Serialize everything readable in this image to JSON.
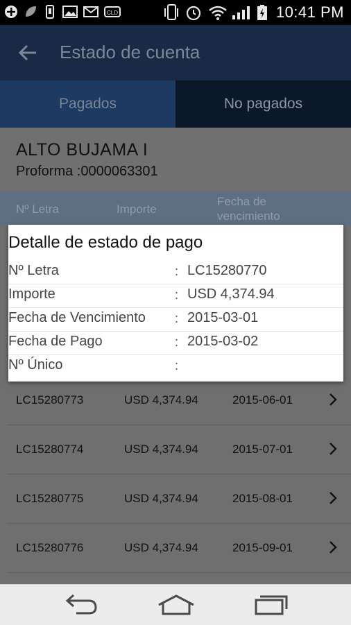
{
  "status_bar": {
    "time": "10:41 PM",
    "icons": [
      "add-icon",
      "leaf-icon",
      "usb-icon",
      "image-icon",
      "gmail-icon",
      "cloud-drive-icon",
      "phone-vibrate-icon",
      "alarm-icon",
      "wifi-icon",
      "signal-icon",
      "battery-icon"
    ]
  },
  "app_bar": {
    "title": "Estado de cuenta",
    "back_icon": "back-arrow-icon"
  },
  "tabs": [
    {
      "label": "Pagados",
      "selected": true
    },
    {
      "label": "No pagados",
      "selected": false
    }
  ],
  "project": {
    "name": "ALTO BUJAMA I",
    "proforma": "Proforma :0000063301"
  },
  "columns": {
    "letra": "Nº Letra",
    "importe": "Importe",
    "fecha": "Fecha de vencimiento"
  },
  "rows": [
    {
      "letra": "LC15280773",
      "importe": "USD 4,374.94",
      "fecha": "2015-06-01"
    },
    {
      "letra": "LC15280774",
      "importe": "USD 4,374.94",
      "fecha": "2015-07-01"
    },
    {
      "letra": "LC15280775",
      "importe": "USD 4,374.94",
      "fecha": "2015-08-01"
    },
    {
      "letra": "LC15280776",
      "importe": "USD 4,374.94",
      "fecha": "2015-09-01"
    }
  ],
  "dialog": {
    "title": "Detalle de estado de pago",
    "fields": [
      {
        "label": "Nº Letra",
        "value": "LC15280770"
      },
      {
        "label": "Importe",
        "value": "USD 4,374.94"
      },
      {
        "label": "Fecha de Vencimiento",
        "value": "2015-03-01"
      },
      {
        "label": "Fecha de Pago",
        "value": "2015-03-02"
      },
      {
        "label": "Nº Único",
        "value": ""
      }
    ],
    "separator": ":"
  },
  "nav_bar": {
    "icons": [
      "back-nav-icon",
      "home-nav-icon",
      "recent-apps-icon"
    ]
  },
  "colors": {
    "app_bar": "#182a46",
    "tab_selected": "#1c3a62",
    "tab_unselected": "#0b1829",
    "dim_overlay": "#6f6f6f"
  }
}
